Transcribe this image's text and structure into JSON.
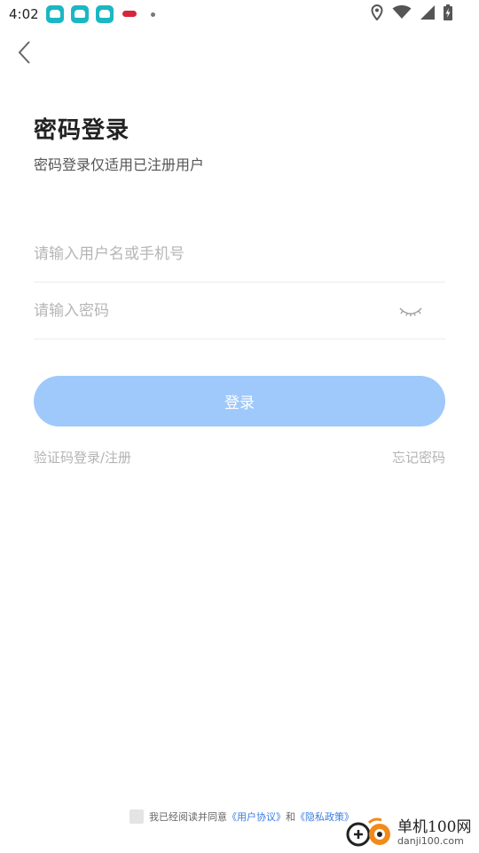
{
  "status_bar": {
    "time": "4:02",
    "icons": [
      "car-app-icon",
      "car-app-icon",
      "car-app-icon",
      "lips-app-icon",
      "notification-dot",
      "location-icon",
      "wifi-icon",
      "signal-icon",
      "battery-charging-icon"
    ]
  },
  "header": {
    "back_icon": "chevron-left-icon"
  },
  "title": "密码登录",
  "subtitle": "密码登录仅适用已注册用户",
  "form": {
    "username_placeholder": "请输入用户名或手机号",
    "password_placeholder": "请输入密码",
    "eye_icon": "eye-closed-icon"
  },
  "login_button": "登录",
  "links": {
    "code_login": "验证码登录/注册",
    "forgot_password": "忘记密码"
  },
  "agreement": {
    "prefix": "我已经阅读并同意",
    "user_agreement": "《用户协议》",
    "and": "和",
    "privacy_policy": "《隐私政策》"
  },
  "watermark": {
    "title": "单机100网",
    "url": "danji100.com"
  },
  "colors": {
    "button_bg": "#9fc9fb",
    "link": "#3a7de0",
    "placeholder": "#b6b6b6"
  }
}
